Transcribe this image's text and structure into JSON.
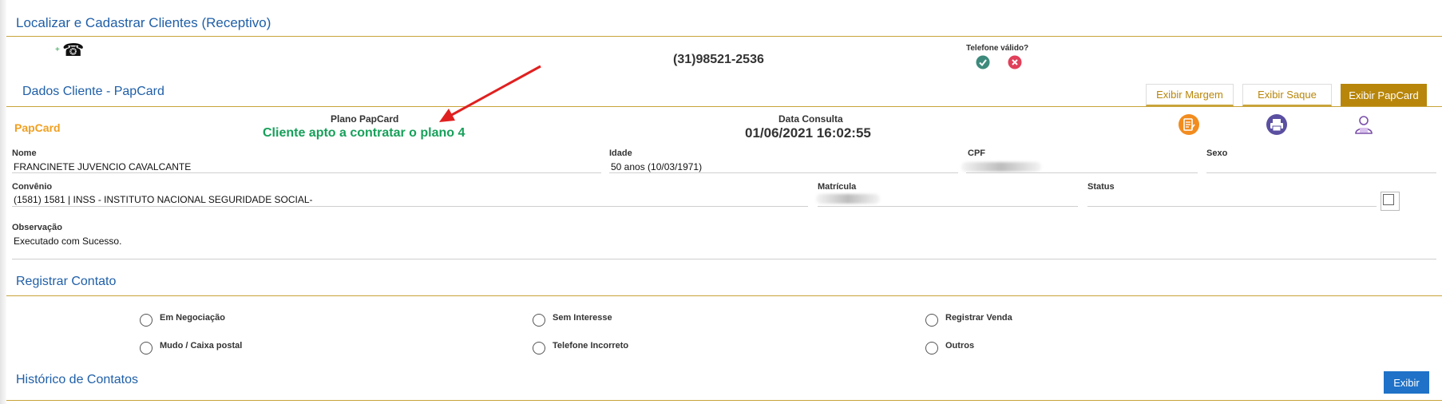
{
  "header": {
    "title": "Localizar e Cadastrar Clientes (Receptivo)"
  },
  "phone": {
    "number": "(31)98521-2536",
    "valid_label": "Telefone válido?",
    "plus": "+",
    "phone_glyph": "☎"
  },
  "client_section": {
    "title": "Dados Cliente - PapCard",
    "buttons": {
      "margem": "Exibir Margem",
      "saque": "Exibir Saque",
      "papcard": "Exibir PapCard"
    },
    "brand": "PapCard",
    "plano_label": "Plano PapCard",
    "plano_value": "Cliente apto a contratar o plano 4",
    "data_label": "Data Consulta",
    "data_value": "01/06/2021 16:02:55",
    "fields": {
      "nome_label": "Nome",
      "nome_value": "FRANCINETE JUVENCIO CAVALCANTE",
      "idade_label": "Idade",
      "idade_value": "50 anos (10/03/1971)",
      "cpf_label": "CPF",
      "sexo_label": "Sexo",
      "convenio_label": "Convênio",
      "convenio_value": "(1581) 1581 | INSS - INSTITUTO NACIONAL SEGURIDADE SOCIAL-",
      "matricula_label": "Matrícula",
      "status_label": "Status",
      "observacao_label": "Observação",
      "observacao_value": "Executado com Sucesso."
    }
  },
  "contact_section": {
    "title": "Registrar Contato",
    "options": [
      "Em Negociação",
      "Sem Interesse",
      "Registrar Venda",
      "Mudo / Caixa postal",
      "Telefone Incorreto",
      "Outros"
    ]
  },
  "history_section": {
    "title": "Histórico de Contatos",
    "button": "Exibir"
  },
  "colors": {
    "accent_blue": "#1f5fa8",
    "gold": "#b8860b",
    "green_text": "#17a05a",
    "papcard_orange": "#f0a020",
    "arrow_red": "#e02020"
  }
}
